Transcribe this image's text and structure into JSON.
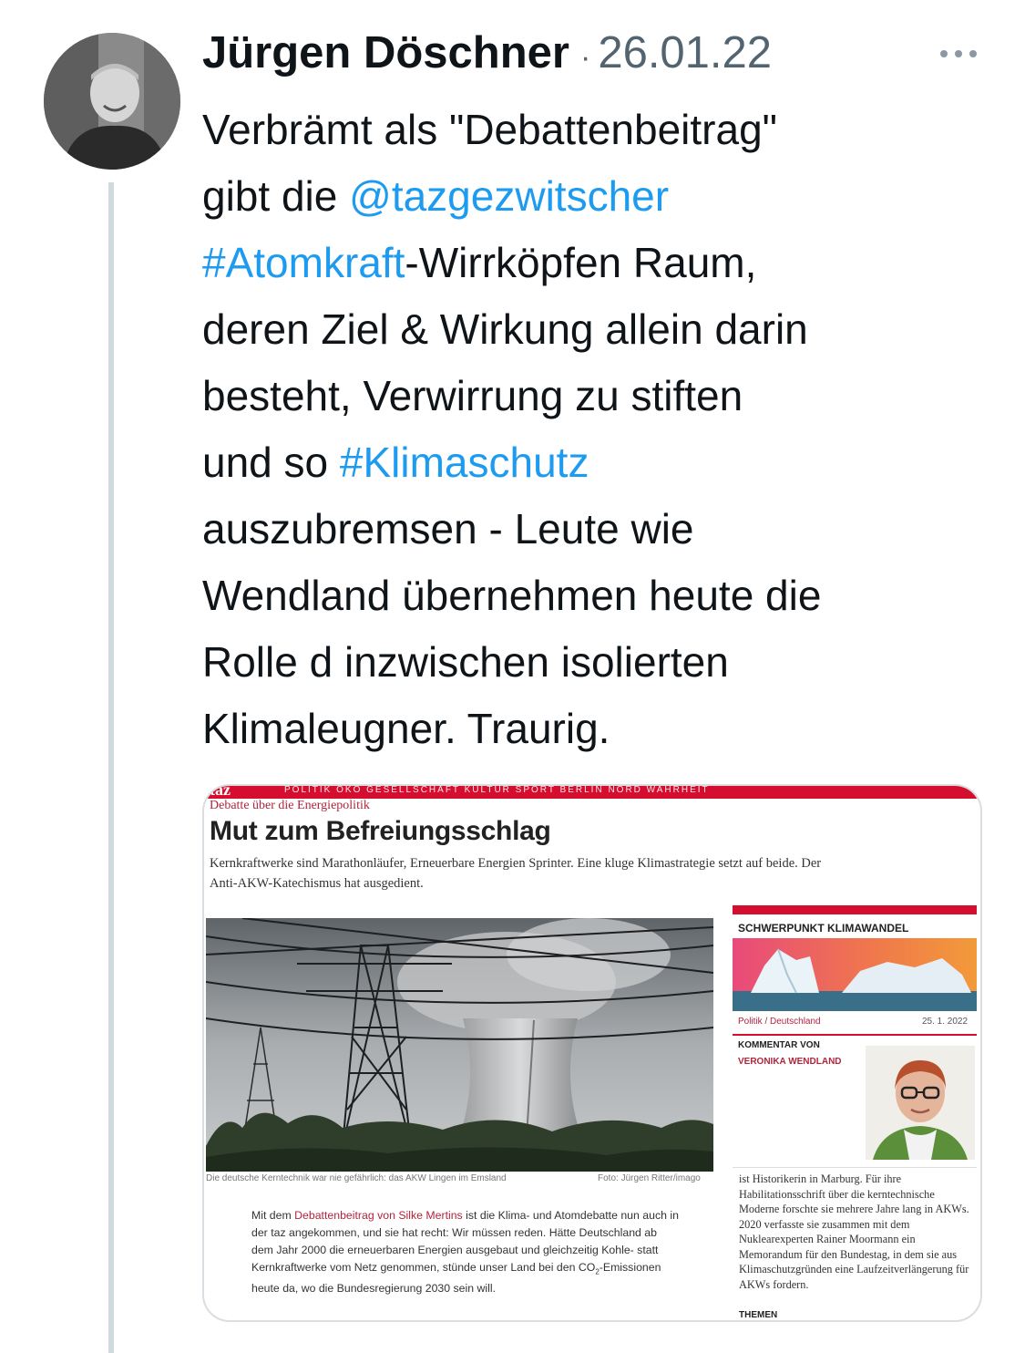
{
  "tweet": {
    "author": "Jürgen Döschner",
    "separator": "·",
    "date": "26.01.22",
    "text_lines": [
      [
        {
          "t": "Verbrämt als \"Debattenbeitrag\""
        }
      ],
      [
        {
          "t": "gibt die "
        },
        {
          "t": "@tazgezwitscher",
          "link": true,
          "name": "mention-tazgezwitscher"
        }
      ],
      [
        {
          "t": "#Atomkraft",
          "link": true,
          "name": "hashtag-atomkraft"
        },
        {
          "t": "-Wirrköpfen Raum,"
        }
      ],
      [
        {
          "t": "deren Ziel & Wirkung allein darin"
        }
      ],
      [
        {
          "t": "besteht, Verwirrung zu stiften"
        }
      ],
      [
        {
          "t": "und so "
        },
        {
          "t": "#Klimaschutz",
          "link": true,
          "name": "hashtag-klimaschutz"
        }
      ],
      [
        {
          "t": "auszubremsen - Leute wie"
        }
      ],
      [
        {
          "t": "Wendland übernehmen heute die"
        }
      ],
      [
        {
          "t": "Rolle d inzwischen isolierten"
        }
      ],
      [
        {
          "t": "Klimaleugner. Traurig."
        }
      ]
    ]
  },
  "article": {
    "logo": "taz",
    "nav": "POLITIK  ÖKO  GESELLSCHAFT  KULTUR  SPORT  BERLIN  NORD  WAHRHEIT",
    "kicker": "Debatte über die Energiepolitik",
    "headline": "Mut zum Befreiungsschlag",
    "teaser": "Kernkraftwerke sind Marathonläufer, Erneuerbare Energien Sprinter. Eine kluge Klimastrategie setzt auf beide. Der Anti-AKW-Katechismus hat ausgedient.",
    "caption": "Die deutsche Kerntechnik war nie gefährlich: das AKW Lingen im Emsland",
    "credit": "Foto: Jürgen Ritter/imago",
    "body_pre": "Mit dem ",
    "body_link": "Debattenbeitrag von Silke Mertins",
    "body_mid": " ist die Klima- und Atomdebatte nun auch in der taz angekommen, und sie hat recht: Wir müssen reden. Hätte Deutschland ab dem Jahr 2000 die erneuerbaren Energien ausgebaut und gleichzeitig Kohle- statt Kernkraftwerke vom Netz genommen, stünde unser Land bei den CO",
    "body_sub": "2",
    "body_post": "-Emissionen heute da, wo die Bundesregierung 2030 sein will."
  },
  "sidebar": {
    "title": "SCHWERPUNKT KLIMAWANDEL",
    "category": "Politik / Deutschland",
    "date": "25. 1. 2022",
    "comment_label": "KOMMENTAR VON",
    "comment_author": "VERONIKA WENDLAND",
    "bio": "ist Historikerin in Marburg. Für ihre Habilitationsschrift über die kerntechnische Moderne forschte sie mehrere Jahre lang in AKWs. 2020 verfasste sie zusammen mit dem Nuklearexperten Rainer Moormann ein Memorandum für den Bundestag, in dem sie aus Klimaschutzgründen eine Laufzeitverlängerung für AKWs fordern.",
    "themen": "THEMEN"
  },
  "colors": {
    "link": "#1d9bf0",
    "taz_red": "#d50d2e",
    "muted": "#536471"
  }
}
